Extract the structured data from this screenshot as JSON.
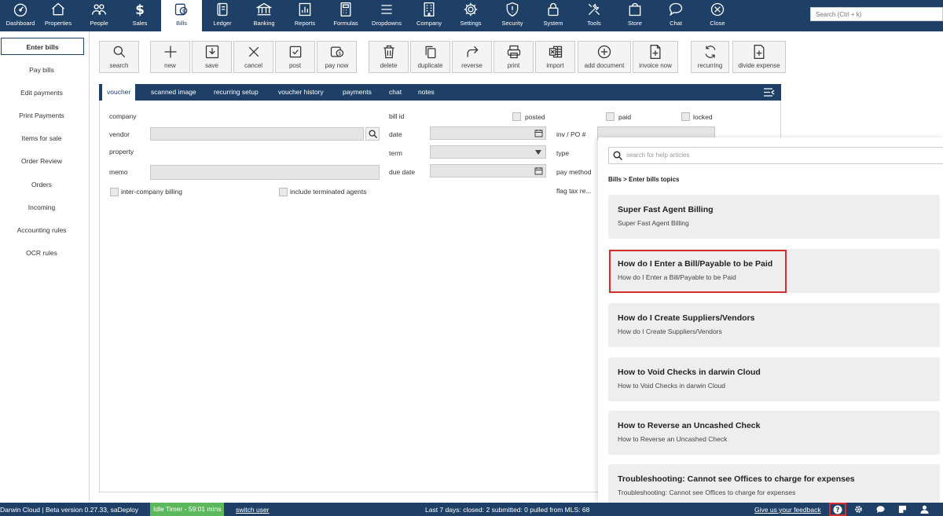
{
  "nav": [
    {
      "label": "Dashboard",
      "icon": "dashboard-icon"
    },
    {
      "label": "Properties",
      "icon": "home-icon"
    },
    {
      "label": "People",
      "icon": "people-icon"
    },
    {
      "label": "Sales",
      "icon": "dollar-icon"
    },
    {
      "label": "Bills",
      "icon": "bills-icon",
      "active": true
    },
    {
      "label": "Ledger",
      "icon": "ledger-icon"
    },
    {
      "label": "Banking",
      "icon": "bank-icon"
    },
    {
      "label": "Reports",
      "icon": "reports-icon"
    },
    {
      "label": "Formulas",
      "icon": "calculator-icon"
    },
    {
      "label": "Dropdowns",
      "icon": "menu-icon"
    },
    {
      "label": "Company",
      "icon": "building-icon"
    },
    {
      "label": "Settings",
      "icon": "gear-icon"
    },
    {
      "label": "Security",
      "icon": "shield-icon"
    },
    {
      "label": "System",
      "icon": "lock-icon"
    },
    {
      "label": "Tools",
      "icon": "tools-icon"
    },
    {
      "label": "Store",
      "icon": "bag-icon"
    },
    {
      "label": "Chat",
      "icon": "chat-icon"
    },
    {
      "label": "Close",
      "icon": "close-icon"
    }
  ],
  "global_search": {
    "placeholder": "Search (Ctrl + k)"
  },
  "sidebar": {
    "items": [
      {
        "label": "Enter bills",
        "active": true
      },
      {
        "label": "Pay bills"
      },
      {
        "label": "Edit payments"
      },
      {
        "label": "Print Payments"
      },
      {
        "label": "Items for sale"
      },
      {
        "label": "Order Review"
      },
      {
        "label": "Orders"
      },
      {
        "label": "Incoming"
      },
      {
        "label": "Accounting rules"
      },
      {
        "label": "OCR rules"
      }
    ]
  },
  "toolbar": [
    {
      "label": "search",
      "icon": "search-icon"
    },
    {
      "label": "new",
      "icon": "plus-icon"
    },
    {
      "label": "save",
      "icon": "save-icon"
    },
    {
      "label": "cancel",
      "icon": "x-icon"
    },
    {
      "label": "post",
      "icon": "check-icon"
    },
    {
      "label": "pay now",
      "icon": "pay-icon"
    },
    {
      "label": "delete",
      "icon": "trash-icon"
    },
    {
      "label": "duplicate",
      "icon": "copy-icon"
    },
    {
      "label": "reverse",
      "icon": "reverse-icon"
    },
    {
      "label": "print",
      "icon": "printer-icon"
    },
    {
      "label": "import",
      "icon": "excel-icon"
    },
    {
      "label": "add document",
      "icon": "plus-circle-icon"
    },
    {
      "label": "invoice now",
      "icon": "invoice-icon"
    },
    {
      "label": "recurring",
      "icon": "refresh-icon"
    },
    {
      "label": "divide expense",
      "icon": "divide-icon"
    }
  ],
  "tabs": [
    "voucher",
    "scanned image",
    "recurring setup",
    "voucher history",
    "payments",
    "chat",
    "notes"
  ],
  "form": {
    "company": "company",
    "vendor": "vendor",
    "property": "property",
    "memo": "memo",
    "inter_company": "inter-company billing",
    "include_terminated": "include terminated agents",
    "bill_id": "bill id",
    "posted": "posted",
    "date": "date",
    "term": "term",
    "due_date": "due date",
    "paid": "paid",
    "locked": "locked",
    "inv_po": "inv / PO #",
    "type": "type",
    "pay_method": "pay method",
    "flag_tax": "flag tax re..."
  },
  "help": {
    "search_placeholder": "search for help articles",
    "breadcrumb": "Bills > Enter bills topics",
    "articles": [
      {
        "title": "Super Fast Agent Billing",
        "subtitle": "Super Fast Agent Billing"
      },
      {
        "title": "How do I Enter a Bill/Payable to be Paid",
        "subtitle": "How do I Enter a Bill/Payable to be Paid"
      },
      {
        "title": "How do I Create Suppliers/Vendors",
        "subtitle": "How do I Create Suppliers/Vendors"
      },
      {
        "title": "How to Void Checks in darwin Cloud",
        "subtitle": "How to Void Checks in darwin Cloud"
      },
      {
        "title": "How to Reverse an Uncashed Check",
        "subtitle": "How to Reverse an Uncashed Check"
      },
      {
        "title": "Troubleshooting: Cannot see Offices to charge for expenses",
        "subtitle": "Troubleshooting: Cannot see Offices to charge for expenses"
      }
    ]
  },
  "status": {
    "version": "Darwin Cloud | Beta version 0.27.33, saDeploy",
    "idle": "Idle Timer - 59:01 mins",
    "switch_user": "switch user",
    "summary": "Last 7 days: closed: 2 submitted: 0 pulled from MLS: 68",
    "feedback": "Give us your feedback"
  },
  "colors": {
    "nav_bg": "#1e3f66",
    "highlight": "#d32f2f",
    "idle_bg": "#5cb85c"
  }
}
